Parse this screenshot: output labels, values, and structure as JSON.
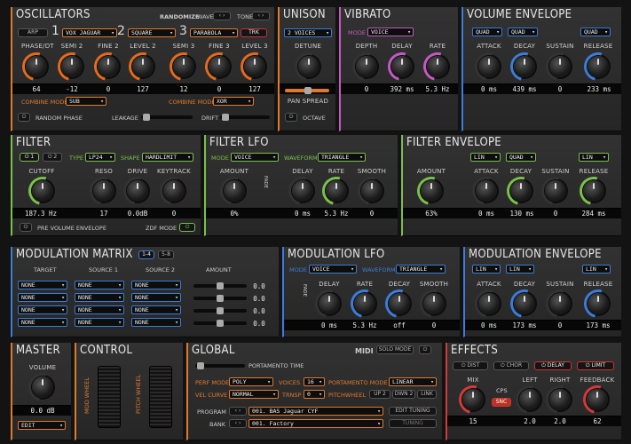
{
  "osc": {
    "title": "OSCILLATORS",
    "randomize": "RANDOMIZE",
    "wave": "WAVE",
    "tone": "TONE",
    "arp": "ARP",
    "n1": "1",
    "w1": "VOX JAGUAR",
    "n2": "2",
    "w2": "SQUARE",
    "n3": "3",
    "w3": "PARABOLA",
    "trk": "TRK",
    "knobs": [
      "PHASE/DT",
      "SEMI 2",
      "FINE 2",
      "LEVEL 2",
      "SEMI 3",
      "FINE 3",
      "LEVEL 3"
    ],
    "values": [
      "64",
      "-12",
      "0",
      "127",
      "12",
      "0",
      "127"
    ],
    "combine": "COMBINE MODE",
    "comb1": "SUB",
    "comb2": "XOR",
    "random_phase": "RANDOM PHASE",
    "leakage": "LEAKAGE",
    "drift": "DRIFT"
  },
  "unison": {
    "title": "UNISON",
    "voices": "2 VOICES",
    "detune": "DETUNE",
    "pan": "PAN SPREAD",
    "octave": "OCTAVE"
  },
  "vibrato": {
    "title": "VIBRATO",
    "mode_label": "MODE",
    "mode": "VOICE",
    "knobs": [
      "DEPTH",
      "DELAY",
      "RATE"
    ],
    "values": [
      "0",
      "392 ms",
      "5.3 Hz"
    ]
  },
  "volenv": {
    "title": "VOLUME ENVELOPE",
    "s1": "QUAD",
    "s2": "QUAD",
    "s3": "QUAD",
    "knobs": [
      "ATTACK",
      "DECAY",
      "SUSTAIN",
      "RELEASE"
    ],
    "values": [
      "0 ms",
      "439 ms",
      "0",
      "233 ms"
    ]
  },
  "filter": {
    "title": "FILTER",
    "b1": "1",
    "b2": "2",
    "type_label": "TYPE",
    "type": "LP24",
    "shape_label": "SHAPE",
    "shape": "HARDLIMIT",
    "knobs": [
      "CUTOFF",
      "RESO",
      "DRIVE",
      "KEYTRACK"
    ],
    "values": [
      "187.3 Hz",
      "17",
      "0.0dB",
      "0"
    ],
    "pre": "PRE VOLUME ENVELOPE",
    "zdf": "ZDF MODE"
  },
  "flfo": {
    "title": "FILTER LFO",
    "mode_label": "MODE",
    "mode": "VOICE",
    "wf_label": "WAVEFORM",
    "wf": "TRIANGLE",
    "fade": "FADE",
    "knobs": [
      "AMOUNT",
      "DELAY",
      "RATE",
      "SMOOTH"
    ],
    "values": [
      "0%",
      "0 ms",
      "5.3 Hz",
      "0"
    ]
  },
  "fenv": {
    "title": "FILTER ENVELOPE",
    "s1": "LIN",
    "s2": "QUAD",
    "s3": "LIN",
    "knobs": [
      "AMOUNT",
      "ATTACK",
      "DECAY",
      "SUSTAIN",
      "RELEASE"
    ],
    "values": [
      "63%",
      "0 ms",
      "130 ms",
      "0",
      "284 ms"
    ]
  },
  "matrix": {
    "title": "MODULATION MATRIX",
    "p1": "1-4",
    "p2": "5-8",
    "h_target": "TARGET",
    "h_s1": "SOURCE 1",
    "h_s2": "SOURCE 2",
    "h_amt": "AMOUNT",
    "none": "NONE",
    "amts": [
      "0.0",
      "0.0",
      "0.0",
      "0.0"
    ]
  },
  "mlfo": {
    "title": "MODULATION LFO",
    "mode_label": "MODE",
    "mode": "VOICE",
    "wf_label": "WAVEFORM",
    "wf": "TRIANGLE",
    "fade": "FADE",
    "knobs": [
      "DELAY",
      "RATE",
      "DECAY",
      "SMOOTH"
    ],
    "values": [
      "0 ms",
      "5.3 Hz",
      "off",
      "0"
    ]
  },
  "menv": {
    "title": "MODULATION ENVELOPE",
    "s1": "LIN",
    "s2": "LIN",
    "s3": "LIN",
    "knobs": [
      "ATTACK",
      "DECAY",
      "SUSTAIN",
      "RELEASE"
    ],
    "values": [
      "0 ms",
      "173 ms",
      "0",
      "173 ms"
    ]
  },
  "master": {
    "title": "MASTER",
    "vol": "VOLUME",
    "value": "0.0 dB",
    "edit": "EDIT"
  },
  "control": {
    "title": "CONTROL",
    "mod": "MOD WHEEL",
    "pitch": "PITCH WHEEL"
  },
  "global": {
    "title": "GLOBAL",
    "midi": "MIDI",
    "solo": "SOLO MODE",
    "porta_time": "PORTAMENTO TIME",
    "perf_label": "PERF MODE",
    "perf": "POLY",
    "voices_label": "VOICES",
    "voices": "16",
    "porta_label": "PORTAMENTO MODE",
    "porta": "LINEAR",
    "vel_label": "VEL CURVE",
    "vel": "NORMAL",
    "transp_label": "TRNSP",
    "transp": "0",
    "pw_label": "PITCHWHEEL",
    "up": "UP 2",
    "down": "DWN 2",
    "link": "LINK",
    "program_label": "PROGRAM",
    "program": "001. BAS Jaguar CYF",
    "bank_label": "BANK",
    "bank": "001. Factory",
    "edit_tuning": "EDIT TUNING",
    "tuning": "TUNING"
  },
  "fx": {
    "title": "EFFECTS",
    "dist": "DIST",
    "chor": "CHOR",
    "delay": "DELAY",
    "limit": "LIMIT",
    "knobs": [
      "MIX",
      "LEFT",
      "RIGHT",
      "FEEDBACK"
    ],
    "cps": "CPS",
    "snc": "SNC",
    "values": [
      "15",
      "2.0",
      "2.0",
      "62"
    ]
  }
}
